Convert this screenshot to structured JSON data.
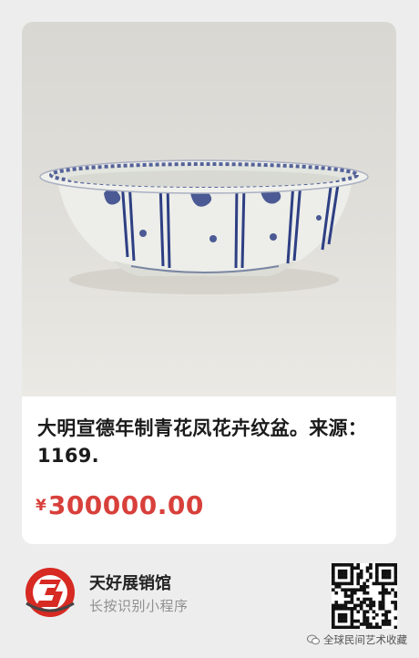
{
  "card": {
    "product_image_alt": "blue-and-white-porcelain-basin-photo",
    "title": "大明宣德年制青花凤花卉纹盆。来源：1169.",
    "price_currency": "¥",
    "price_amount": "300000.00"
  },
  "footer": {
    "brand_name": "天好展销馆",
    "hint": "长按识别小程序",
    "watermark": "全球民间艺术收藏"
  },
  "colors": {
    "price": "#d8403b",
    "logo_red": "#d62a22",
    "background": "#ededed"
  }
}
